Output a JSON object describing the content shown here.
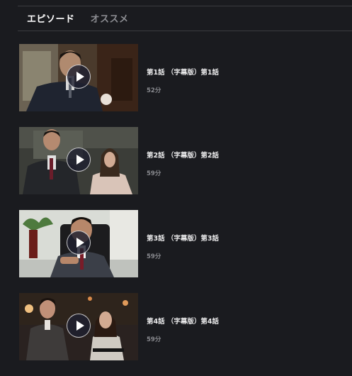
{
  "tabs": {
    "episodes_label": "エピソード",
    "recommended_label": "オススメ"
  },
  "episodes": [
    {
      "title": "第1話 （字幕版）第1話",
      "duration": "52分"
    },
    {
      "title": "第2話 （字幕版）第2話",
      "duration": "59分"
    },
    {
      "title": "第3話 （字幕版）第3話",
      "duration": "59分"
    },
    {
      "title": "第4話 （字幕版）第4話",
      "duration": "59分"
    }
  ],
  "colors": {
    "background": "#1a1b1f",
    "tab_active": "#ffffff",
    "tab_inactive": "#8d8e93",
    "title_text": "#e9e9ea",
    "duration_text": "#8a8b90"
  },
  "icons": {
    "play": "play-icon"
  }
}
